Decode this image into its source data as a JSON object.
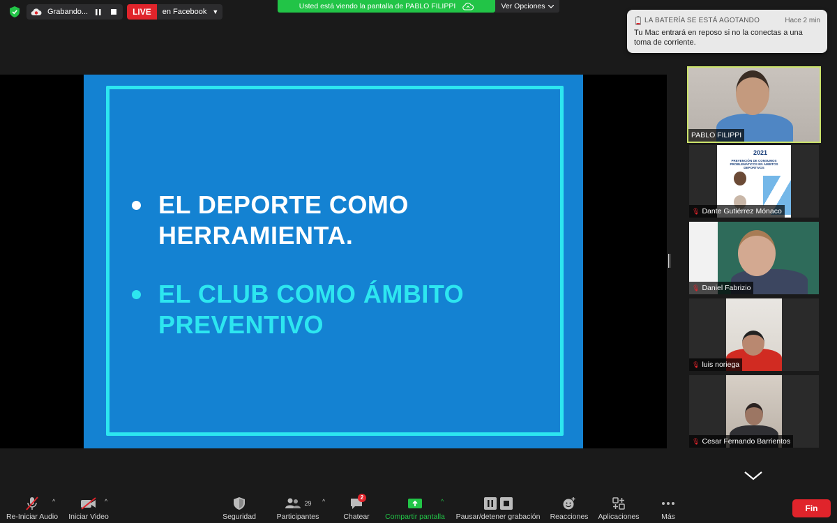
{
  "topbar": {
    "recording_label": "Grabando...",
    "live_badge": "LIVE",
    "live_target": "en Facebook"
  },
  "share_banner": {
    "text": "Usted está viendo la pantalla de PABLO FILIPPI",
    "view_options": "Ver Opciones"
  },
  "notification": {
    "title": "LA BATERÍA SE ESTÁ AGOTANDO",
    "time": "Hace 2 min",
    "body": "Tu Mac entrará en reposo si no la conectas a una toma de corriente."
  },
  "slide": {
    "bullet1": "EL DEPORTE COMO HERRAMIENTA.",
    "bullet2": "EL CLUB COMO ÁMBITO PREVENTIVO"
  },
  "gallery": {
    "participants": [
      {
        "name": "PABLO FILIPPI",
        "active": true,
        "muted": false
      },
      {
        "name": "Dante Gutiérrez Mónaco",
        "active": false,
        "muted": true
      },
      {
        "name": "Daniel Fabrizio",
        "active": false,
        "muted": true
      },
      {
        "name": "luis noriega",
        "active": false,
        "muted": true
      },
      {
        "name": "Cesar Fernando Barrientos",
        "active": false,
        "muted": true
      }
    ]
  },
  "poster": {
    "year": "2021",
    "heading": "PREVENCIÓN DE CONSUMOS PROBLEMÁTICOS EN ÁMBITOS DEPORTIVOS"
  },
  "toolbar": {
    "audio": "Re-Iniciar Audio",
    "video": "Iniciar Video",
    "security": "Seguridad",
    "participants": "Participantes",
    "participants_count": "29",
    "chat": "Chatear",
    "chat_badge": "2",
    "share": "Compartir pantalla",
    "record": "Pausar/detener grabación",
    "reactions": "Reacciones",
    "apps": "Aplicaciones",
    "more": "Más",
    "end": "Fin"
  },
  "colors": {
    "slide_bg": "#1482d2",
    "slide_accent": "#2de6f0",
    "share_green": "#22c447",
    "live_red": "#e0242b",
    "active_speaker": "#cbe36a"
  }
}
